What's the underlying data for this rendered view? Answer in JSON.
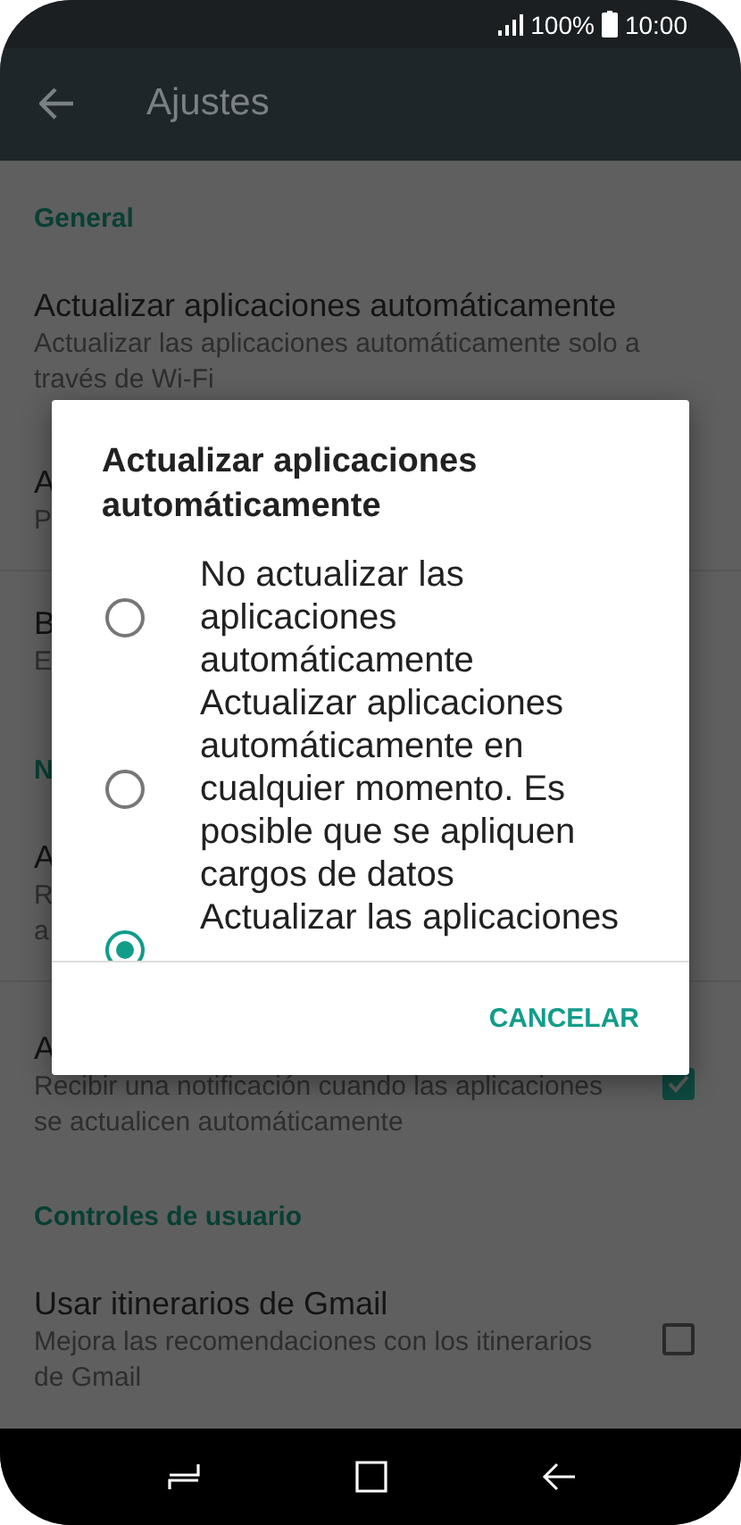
{
  "status_bar": {
    "battery": "100%",
    "time": "10:00"
  },
  "toolbar": {
    "title": "Ajustes"
  },
  "sections": [
    {
      "header": "General",
      "rows": [
        {
          "title": "Actualizar aplicaciones automáticamente",
          "subtitle": "Actualizar las aplicaciones automáticamente solo a través de Wi-Fi"
        },
        {
          "title": "A",
          "subtitle": "P",
          "kind": "covered"
        },
        {
          "title": "B",
          "subtitle": "E",
          "kind": "covered"
        }
      ]
    },
    {
      "header": "N",
      "rows": [
        {
          "title": "A",
          "subtitle": "R a",
          "kind": "covered"
        },
        {
          "title": "A",
          "subtitle": "Recibir una notificación cuando las aplicaciones se actualicen automáticamente",
          "checked": true
        }
      ]
    },
    {
      "header": "Controles de usuario",
      "rows": [
        {
          "title": "Usar itinerarios de Gmail",
          "subtitle": "Mejora las recomendaciones con los itinerarios de Gmail",
          "checked": false
        }
      ]
    }
  ],
  "dialog": {
    "title": "Actualizar aplicaciones automáticamente",
    "options": [
      {
        "label": "No actualizar las aplicaciones automáticamente",
        "selected": false
      },
      {
        "label": "Actualizar aplicaciones automáticamente en cualquier momento. Es posible que se apliquen cargos de datos",
        "selected": false
      },
      {
        "label": "Actualizar las aplicaciones",
        "selected": true
      }
    ],
    "button": "CANCELAR"
  }
}
